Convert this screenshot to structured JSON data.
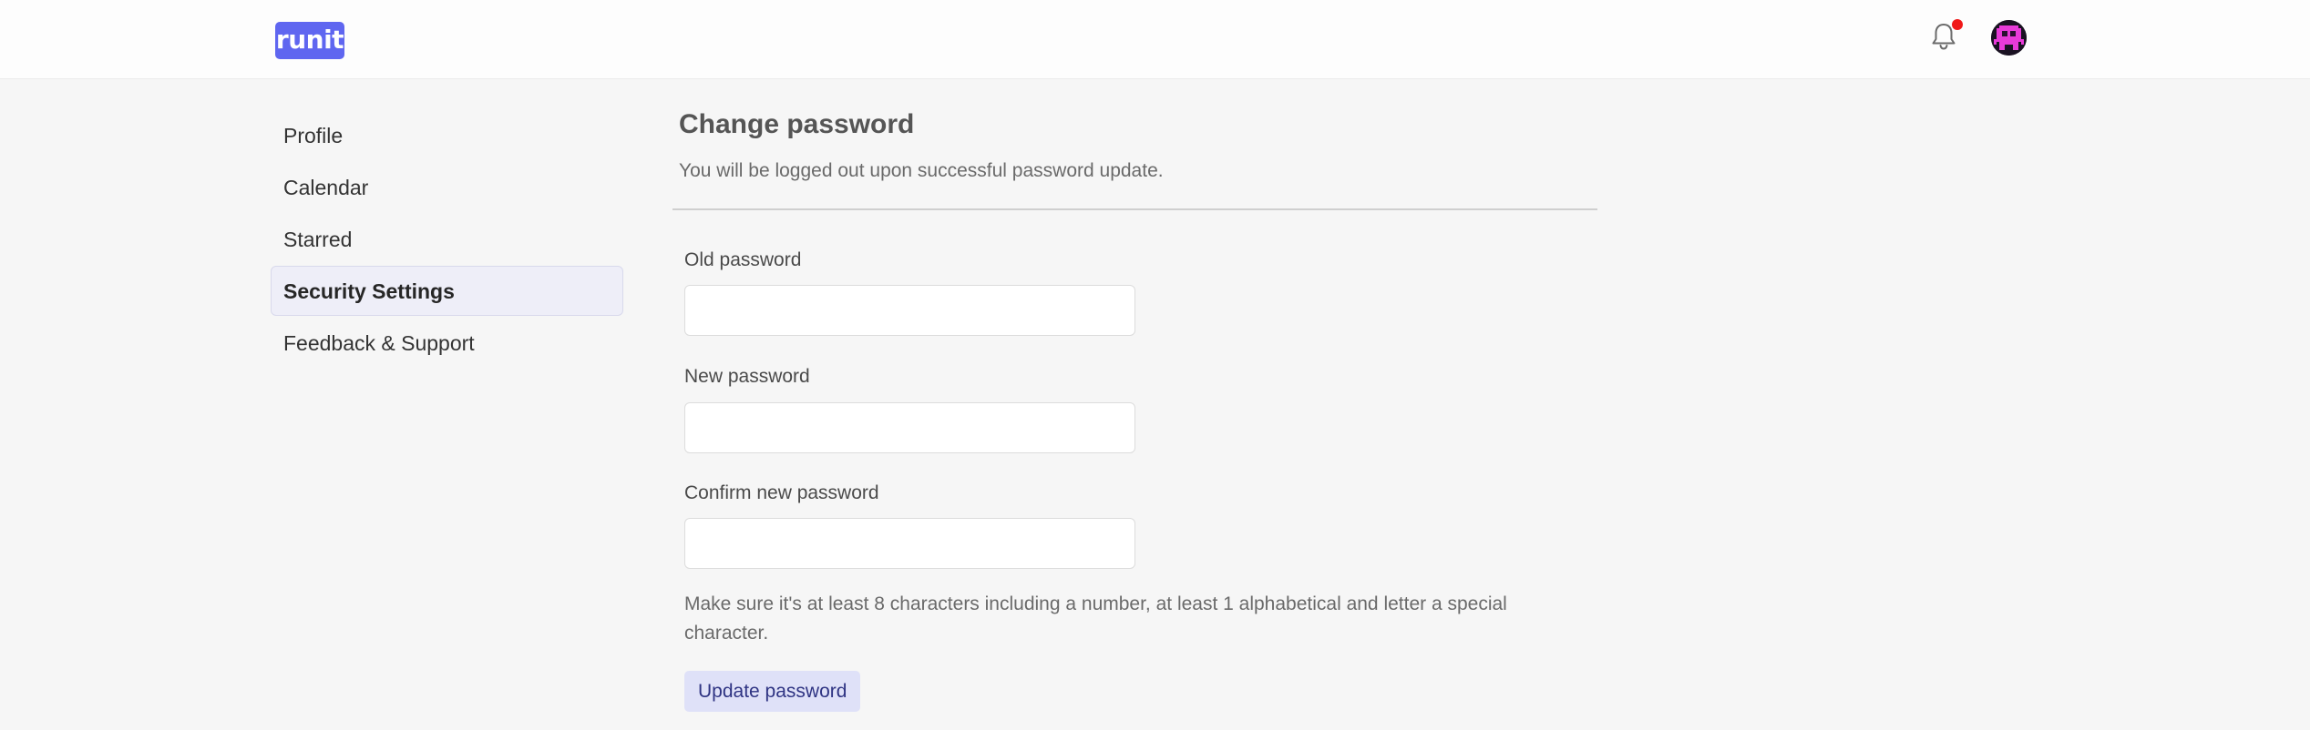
{
  "header": {
    "logo_text": "runit",
    "notification_icon": "bell-icon",
    "notification_badge_color": "#f01818",
    "avatar_icon": "pixel-monster-avatar-icon",
    "brand_color": "#5f66f0"
  },
  "sidebar": {
    "items": [
      {
        "label": "Profile",
        "active": false
      },
      {
        "label": "Calendar",
        "active": false
      },
      {
        "label": "Starred",
        "active": false
      },
      {
        "label": "Security Settings",
        "active": true
      },
      {
        "label": "Feedback & Support",
        "active": false
      }
    ]
  },
  "main": {
    "title": "Change password",
    "subtitle": "You will be logged out upon successful password update.",
    "fields": [
      {
        "label": "Old password",
        "value": "",
        "placeholder": ""
      },
      {
        "label": "New password",
        "value": "",
        "placeholder": ""
      },
      {
        "label": "Confirm new password",
        "value": "",
        "placeholder": ""
      }
    ],
    "hint": "Make sure it's at least 8 characters including a number, at least 1 alphabetical and letter a special character.",
    "submit_label": "Update password"
  }
}
